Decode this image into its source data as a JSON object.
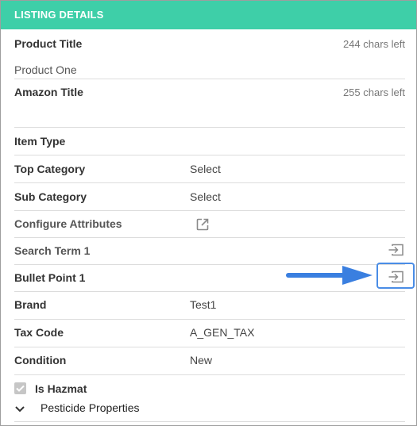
{
  "header": {
    "title": "LISTING DETAILS"
  },
  "product_title": {
    "label": "Product Title",
    "chars_left": "244 chars left",
    "value": "Product One"
  },
  "amazon_title": {
    "label": "Amazon Title",
    "chars_left": "255 chars left",
    "value": ""
  },
  "item_type": {
    "label": "Item Type"
  },
  "top_category": {
    "label": "Top Category",
    "value": "Select"
  },
  "sub_category": {
    "label": "Sub Category",
    "value": "Select"
  },
  "configure_attributes": {
    "label": "Configure Attributes",
    "icon": "external-link-icon"
  },
  "search_term": {
    "label": "Search Term 1",
    "icon": "insert-icon"
  },
  "bullet_point": {
    "label": "Bullet Point 1",
    "icon": "insert-icon"
  },
  "brand": {
    "label": "Brand",
    "value": "Test1"
  },
  "tax_code": {
    "label": "Tax Code",
    "value": "A_GEN_TAX"
  },
  "condition": {
    "label": "Condition",
    "value": "New"
  },
  "hazmat": {
    "label": "Is Hazmat",
    "checked": true
  },
  "pesticide": {
    "label": "Pesticide Properties",
    "icon": "chevron-down-icon"
  },
  "colors": {
    "header_bg": "#3ecfa8",
    "highlight": "#4a8de6"
  }
}
